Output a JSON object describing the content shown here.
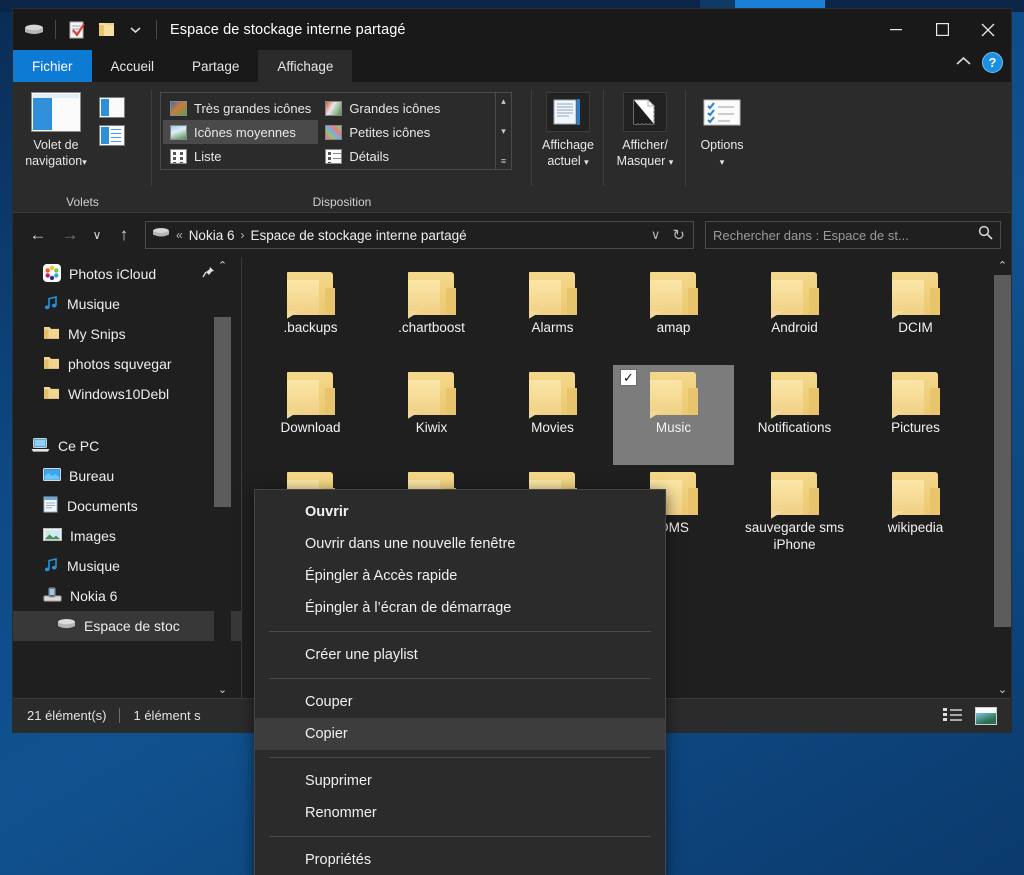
{
  "window": {
    "title": "Espace de stockage interne partagé",
    "quick_access_icons": [
      "drive-icon",
      "properties-icon",
      "new-folder-icon",
      "chevron-down-icon"
    ],
    "controls": {
      "minimize": "─",
      "maximize": "□",
      "close": "✕",
      "collapse_ribbon": "⌃",
      "help": "?"
    }
  },
  "tabs": [
    {
      "label": "Fichier",
      "state": "file"
    },
    {
      "label": "Accueil",
      "state": "normal"
    },
    {
      "label": "Partage",
      "state": "normal"
    },
    {
      "label": "Affichage",
      "state": "active"
    }
  ],
  "ribbon": {
    "groups": [
      {
        "name": "Volets",
        "main_button": {
          "label_line1": "Volet de",
          "label_line2": "navigation",
          "caret": "▾",
          "icon": "navigation-pane-icon"
        },
        "small_buttons": [
          "preview-pane-icon",
          "details-pane-icon"
        ]
      },
      {
        "name": "Disposition",
        "view_items": [
          {
            "label": "Très grandes icônes",
            "icon": "extra-large-icons-icon",
            "selected": false
          },
          {
            "label": "Icônes moyennes",
            "icon": "medium-icons-icon",
            "selected": true
          },
          {
            "label": "Liste",
            "icon": "list-view-icon",
            "selected": false
          },
          {
            "label": "Grandes icônes",
            "icon": "large-icons-icon",
            "selected": false
          },
          {
            "label": "Petites icônes",
            "icon": "small-icons-icon",
            "selected": false
          },
          {
            "label": "Détails",
            "icon": "details-view-icon",
            "selected": false
          }
        ],
        "scroll": {
          "up": "▴",
          "down": "▾",
          "more": "≡"
        }
      },
      {
        "name": "",
        "buttons": [
          {
            "label_line1": "Affichage",
            "label_line2": "actuel",
            "caret": "▾",
            "icon": "current-view-icon"
          },
          {
            "label_line1": "Afficher/",
            "label_line2": "Masquer",
            "caret": "▾",
            "icon": "show-hide-icon"
          },
          {
            "label_line1": "Options",
            "label_line2": "",
            "caret": "▾",
            "icon": "options-icon"
          }
        ]
      }
    ]
  },
  "navbar": {
    "back": "←",
    "forward": "→",
    "recent": "∨",
    "up": "↑",
    "breadcrumb": {
      "device_icon": "drive-icon",
      "overflow": "«",
      "segments": [
        "Nokia 6",
        "Espace de stockage interne partagé"
      ],
      "separator": "›",
      "dropdown": "∨",
      "refresh": "↻"
    },
    "search": {
      "placeholder": "Rechercher dans : Espace de st...",
      "icon": "search-icon"
    }
  },
  "sidebar": {
    "items": [
      {
        "label": "Photos iCloud",
        "icon": "photos-icloud-icon",
        "indent": 1,
        "pinned": true,
        "selected": false
      },
      {
        "label": "Musique",
        "icon": "music-note-icon",
        "indent": 1,
        "pinned": false,
        "selected": false
      },
      {
        "label": "My Snips",
        "icon": "folder-icon",
        "indent": 1,
        "pinned": false,
        "selected": false
      },
      {
        "label": "photos squvegar",
        "icon": "folder-icon",
        "indent": 1,
        "pinned": false,
        "selected": false
      },
      {
        "label": "Windows10Debl",
        "icon": "folder-icon",
        "indent": 1,
        "pinned": false,
        "selected": false
      },
      {
        "label": "",
        "icon": "spacer",
        "indent": 0,
        "pinned": false,
        "selected": false
      },
      {
        "label": "Ce PC",
        "icon": "this-pc-icon",
        "indent": 0,
        "pinned": false,
        "selected": false
      },
      {
        "label": "Bureau",
        "icon": "desktop-icon",
        "indent": 1,
        "pinned": false,
        "selected": false
      },
      {
        "label": "Documents",
        "icon": "documents-icon",
        "indent": 1,
        "pinned": false,
        "selected": false
      },
      {
        "label": "Images",
        "icon": "pictures-icon",
        "indent": 1,
        "pinned": false,
        "selected": false
      },
      {
        "label": "Musique",
        "icon": "music-note-icon",
        "indent": 1,
        "pinned": false,
        "selected": false
      },
      {
        "label": "Nokia 6",
        "icon": "phone-device-icon",
        "indent": 1,
        "pinned": false,
        "selected": false
      },
      {
        "label": "Espace de stoc",
        "icon": "drive-icon",
        "indent": 2,
        "pinned": false,
        "selected": true
      }
    ],
    "scroll": {
      "up": "⌃",
      "down": "⌄"
    }
  },
  "files": [
    {
      "name": ".backups",
      "icon": "folder-icon",
      "selected": false
    },
    {
      "name": ".chartboost",
      "icon": "folder-icon",
      "selected": false
    },
    {
      "name": "Alarms",
      "icon": "folder-icon",
      "selected": false
    },
    {
      "name": "amap",
      "icon": "folder-icon",
      "selected": false
    },
    {
      "name": "Android",
      "icon": "folder-icon",
      "selected": false
    },
    {
      "name": "DCIM",
      "icon": "folder-icon",
      "selected": false
    },
    {
      "name": "Download",
      "icon": "folder-icon",
      "selected": false
    },
    {
      "name": "Kiwix",
      "icon": "folder-icon",
      "selected": false
    },
    {
      "name": "Movies",
      "icon": "folder-icon",
      "selected": false
    },
    {
      "name": "Music",
      "icon": "folder-icon",
      "selected": true
    },
    {
      "name": "Notifications",
      "icon": "folder-icon",
      "selected": false
    },
    {
      "name": "Pictures",
      "icon": "folder-icon",
      "selected": false
    },
    {
      "name": "",
      "icon": "folder-icon",
      "selected": false
    },
    {
      "name": "",
      "icon": "folder-icon",
      "selected": false
    },
    {
      "name": "",
      "icon": "folder-icon",
      "selected": false
    },
    {
      "name": "OMS",
      "icon": "folder-icon",
      "selected": false
    },
    {
      "name": "sauvegarde sms iPhone",
      "icon": "folder-icon",
      "selected": false
    },
    {
      "name": "wikipedia",
      "icon": "folder-icon",
      "selected": false
    }
  ],
  "file_scroll": {
    "up": "⌃",
    "down": "⌄"
  },
  "context_menu": [
    {
      "label": "Ouvrir",
      "bold": true,
      "highlighted": false,
      "separator_after": false
    },
    {
      "label": "Ouvrir dans une nouvelle fenêtre",
      "bold": false,
      "highlighted": false,
      "separator_after": false
    },
    {
      "label": "Épingler à Accès rapide",
      "bold": false,
      "highlighted": false,
      "separator_after": false
    },
    {
      "label": "Épingler à l’écran de démarrage",
      "bold": false,
      "highlighted": false,
      "separator_after": true
    },
    {
      "label": "Créer une playlist",
      "bold": false,
      "highlighted": false,
      "separator_after": true
    },
    {
      "label": "Couper",
      "bold": false,
      "highlighted": false,
      "separator_after": false
    },
    {
      "label": "Copier",
      "bold": false,
      "highlighted": true,
      "separator_after": true
    },
    {
      "label": "Supprimer",
      "bold": false,
      "highlighted": false,
      "separator_after": false
    },
    {
      "label": "Renommer",
      "bold": false,
      "highlighted": false,
      "separator_after": true
    },
    {
      "label": "Propriétés",
      "bold": false,
      "highlighted": false,
      "separator_after": false
    }
  ],
  "statusbar": {
    "item_count": "21 élément(s)",
    "selection": "1 élément s",
    "view_details_icon": "details-view-icon",
    "view_large_icon": "large-icons-icon"
  },
  "colors": {
    "accent_blue": "#0d7bd4",
    "window_bg": "#1f1f1f",
    "ribbon_bg": "#2b2b2b",
    "selection_gray": "#7c7c7c",
    "folder_yellow": "#f0d085",
    "help_blue": "#1a8fe3"
  }
}
